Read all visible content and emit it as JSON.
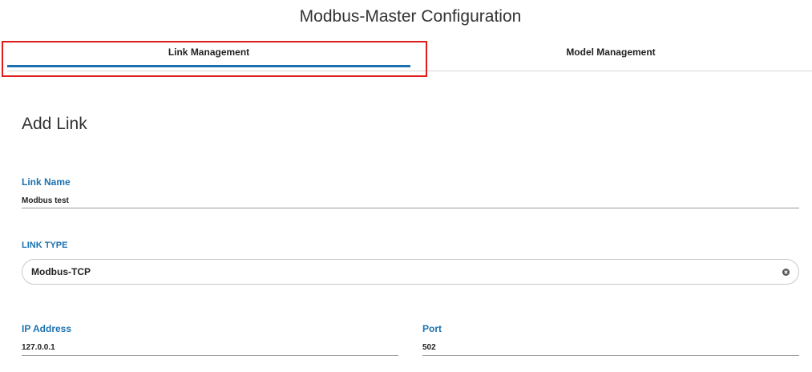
{
  "header": {
    "title": "Modbus-Master Configuration"
  },
  "tabs": [
    {
      "label": "Link Management",
      "active": true
    },
    {
      "label": "Model Management",
      "active": false
    }
  ],
  "form": {
    "section_title": "Add Link",
    "link_name": {
      "label": "Link Name",
      "value": "Modbus test"
    },
    "link_type": {
      "label": "LINK TYPE",
      "value": "Modbus-TCP"
    },
    "ip_address": {
      "label": "IP Address",
      "value": "127.0.0.1"
    },
    "port": {
      "label": "Port",
      "value": "502"
    }
  },
  "colors": {
    "accent": "#1c72b1",
    "highlight_box": "#e01b1b"
  },
  "icons": {
    "clear": "clear-icon"
  }
}
